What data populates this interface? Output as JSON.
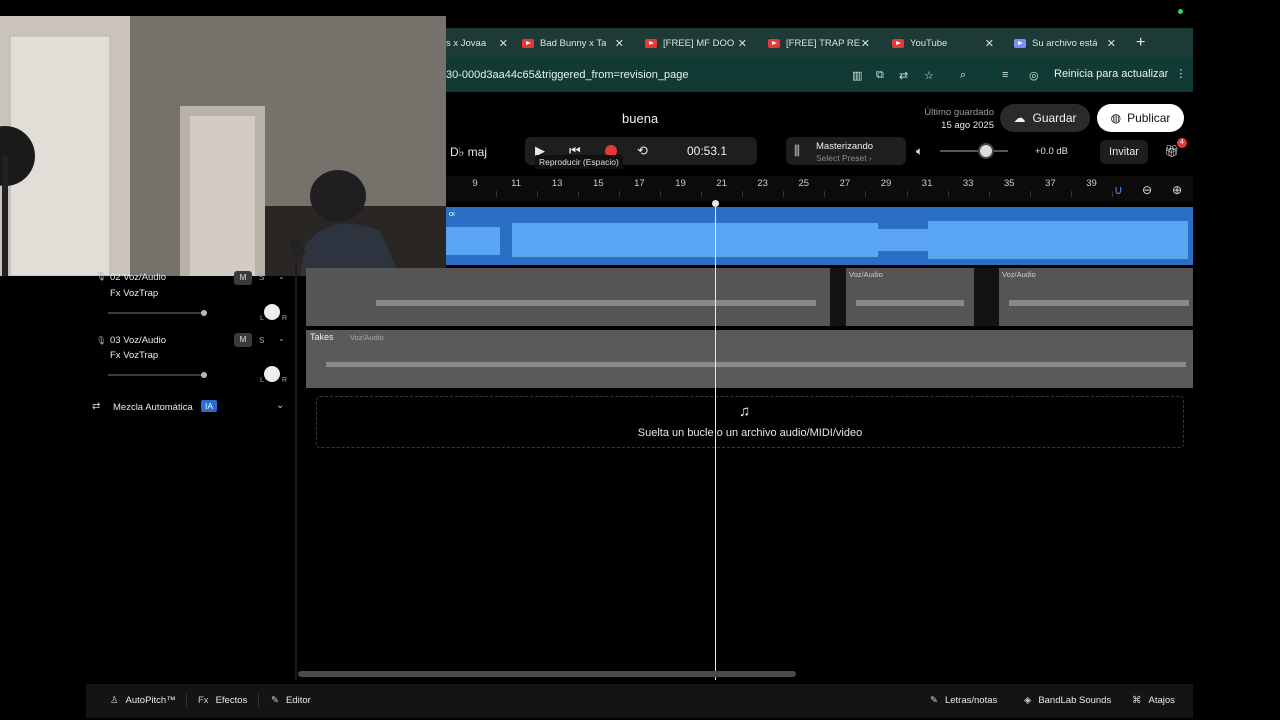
{
  "browser": {
    "tabs": [
      {
        "label": "s x Jovaa",
        "icon": "youtube-icon"
      },
      {
        "label": "Bad Bunny x Ta",
        "icon": "youtube-icon"
      },
      {
        "label": "[FREE] MF DOO",
        "icon": "youtube-icon"
      },
      {
        "label": "[FREE] TRAP RE",
        "icon": "youtube-icon"
      },
      {
        "label": "YouTube",
        "icon": "youtube-icon"
      },
      {
        "label": "Su archivo está",
        "icon": "doc-icon"
      }
    ],
    "url": "30-000d3aa44c65&triggered_from=revision_page",
    "restart_label": "Reinicia para actualizar"
  },
  "header": {
    "project_name": "buena",
    "last_saved_label": "Último guardado",
    "last_saved_date": "15 ago 2025",
    "save_label": "Guardar",
    "publish_label": "Publicar",
    "invite_label": "Invitar",
    "gift_badge": "4"
  },
  "transport": {
    "key": "D♭ maj",
    "time": "00:53.1",
    "tooltip": "Reproducir (Espacio)"
  },
  "mastering": {
    "title": "Masterizando",
    "preset": "Select Preset ›"
  },
  "volume": {
    "db": "+0.0 dB",
    "level": 0.6
  },
  "ruler": {
    "numbers": [
      "9",
      "11",
      "13",
      "15",
      "17",
      "19",
      "21",
      "23",
      "25",
      "27",
      "29",
      "31",
      "33",
      "35",
      "37",
      "39"
    ]
  },
  "tracks": [
    {
      "name": "02  Voz/Audio",
      "fx": "Fx VozTrap",
      "mute": "M",
      "solo": "S"
    },
    {
      "name": "03  Voz/Audio",
      "fx": "Fx VozTrap",
      "mute": "M",
      "solo": "S"
    }
  ],
  "clips": {
    "track1_label": "oi",
    "track2_labels": [
      "Voz/Audio",
      "Voz/Audio"
    ],
    "takes_label": "Takes",
    "takes_sub": "Voz/Audio"
  },
  "automix": {
    "label": "Mezcla Automática",
    "badge": "IA"
  },
  "dropzone": {
    "text": "Suelta un bucle o un archivo audio/MIDI/video"
  },
  "bottom_bar": {
    "autopitch": "AutoPitch™",
    "effects": "Efectos",
    "editor": "Editor",
    "lyrics": "Letras/notas",
    "sounds": "BandLab Sounds",
    "shortcuts": "Atajos"
  },
  "colors": {
    "accent_blue": "#2a6fc4",
    "record_red": "#e53935",
    "browser_bar": "#123a34"
  }
}
